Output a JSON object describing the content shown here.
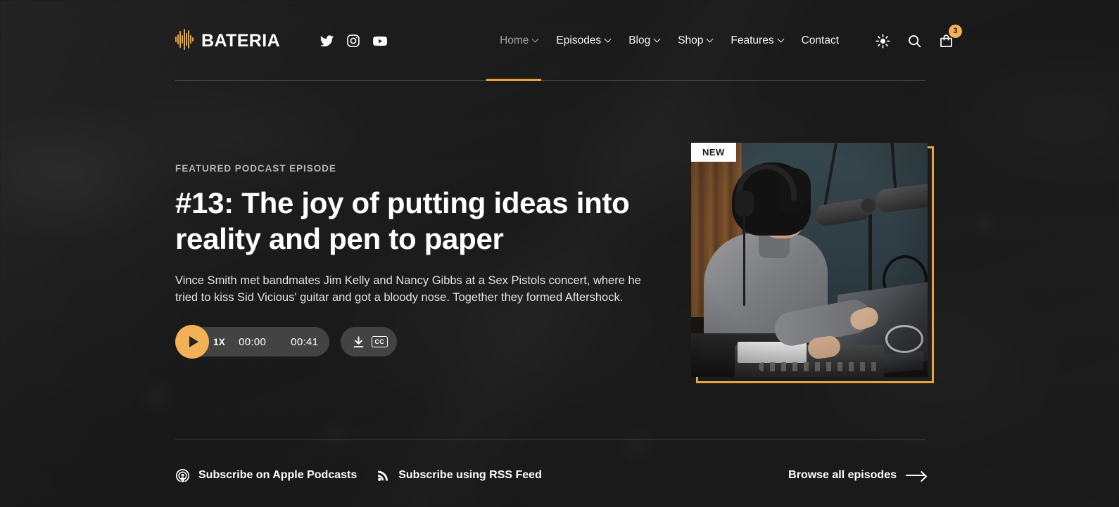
{
  "theme": {
    "accent": "#e8a33d",
    "accent_light": "#f2b155",
    "page_background": "#242424",
    "text_primary": "#ffffff",
    "text_muted": "#b4b4b4"
  },
  "header": {
    "brand": {
      "name": "BATERIA",
      "mark_icon": "waveform-equalizer-icon"
    },
    "socials": [
      {
        "name": "twitter-icon",
        "label": "Twitter"
      },
      {
        "name": "instagram-icon",
        "label": "Instagram"
      },
      {
        "name": "youtube-icon",
        "label": "YouTube"
      }
    ],
    "nav": [
      {
        "label": "Home",
        "has_dropdown": true,
        "active": true
      },
      {
        "label": "Episodes",
        "has_dropdown": true,
        "active": false
      },
      {
        "label": "Blog",
        "has_dropdown": true,
        "active": false
      },
      {
        "label": "Shop",
        "has_dropdown": true,
        "active": false
      },
      {
        "label": "Features",
        "has_dropdown": true,
        "active": false
      },
      {
        "label": "Contact",
        "has_dropdown": false,
        "active": false
      }
    ],
    "actions": {
      "theme_toggle_icon": "sun-icon",
      "search_icon": "search-icon",
      "cart_icon": "shopping-bag-icon",
      "cart_count": "3"
    }
  },
  "hero": {
    "eyebrow": "FEATURED PODCAST EPISODE",
    "title": "#13: The joy of putting ideas into reality and pen to paper",
    "description": "Vince Smith met bandmates Jim Kelly and Nancy Gibbs at a Sex Pistols concert, where he tried to kiss Sid Vicious' guitar and got a bloody nose. Together they formed Aftershock.",
    "image": {
      "badge": "NEW",
      "alt": "Podcast host wearing headphones speaking into a studio microphone beside a laptop"
    }
  },
  "player": {
    "play_icon": "play-icon",
    "speed_label": "1X",
    "current_time": "00:00",
    "duration": "00:41",
    "progress_percent": 0,
    "download_icon": "download-icon",
    "captions_label": "CC",
    "captions_icon": "closed-captions-icon"
  },
  "footer": {
    "subscribe_links": [
      {
        "label": "Subscribe on Apple Podcasts",
        "icon": "apple-podcasts-icon"
      },
      {
        "label": "Subscribe using RSS Feed",
        "icon": "rss-icon"
      }
    ],
    "browse": {
      "label": "Browse all episodes",
      "icon": "arrow-right-icon"
    }
  }
}
